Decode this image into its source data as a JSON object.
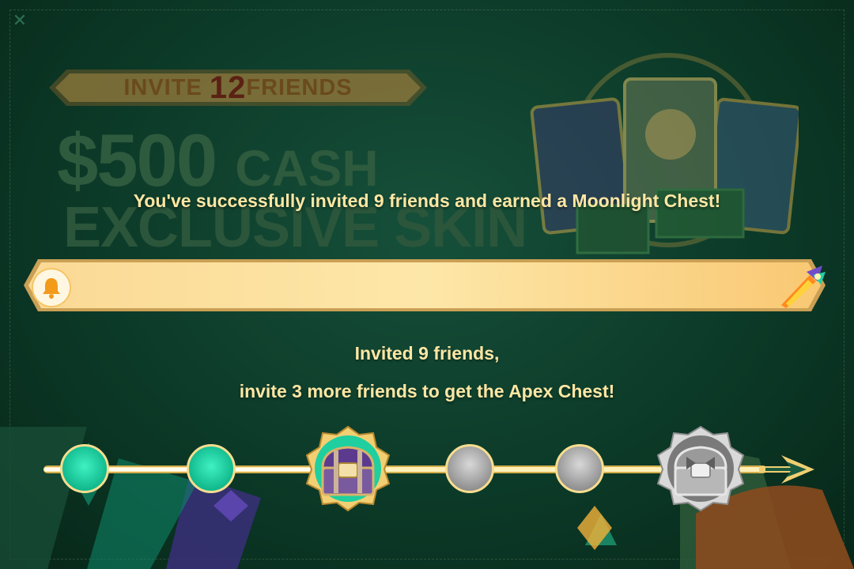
{
  "promo": {
    "banner_prefix": "INVITE ",
    "banner_number": "12",
    "banner_suffix": "FRIENDS",
    "cash_amount": "$500",
    "cash_label": "CASH",
    "skin_label": "EXCLUSIVE SKIN"
  },
  "headline": "You've successfully invited 9 friends and earned a Moonlight Chest!",
  "notification": {
    "message": ""
  },
  "progress": {
    "line1": "Invited 9 friends,",
    "line2": "invite 3 more friends to get the Apex Chest!",
    "invited": 9,
    "goal": 12,
    "milestones": [
      {
        "type": "node",
        "state": "complete"
      },
      {
        "type": "node",
        "state": "complete"
      },
      {
        "type": "chest",
        "name": "Moonlight Chest",
        "state": "earned"
      },
      {
        "type": "node",
        "state": "locked"
      },
      {
        "type": "node",
        "state": "locked"
      },
      {
        "type": "chest",
        "name": "Apex Chest",
        "state": "locked"
      }
    ]
  },
  "icons": [
    "close-icon",
    "bell-icon",
    "rocket-icon",
    "chest-icon",
    "arrow-icon"
  ],
  "colors": {
    "accent_gold": "#fde7a4",
    "complete_teal": "#1fd2a6",
    "locked_gray": "#9a9a9a",
    "bg": "#0c3a28"
  }
}
